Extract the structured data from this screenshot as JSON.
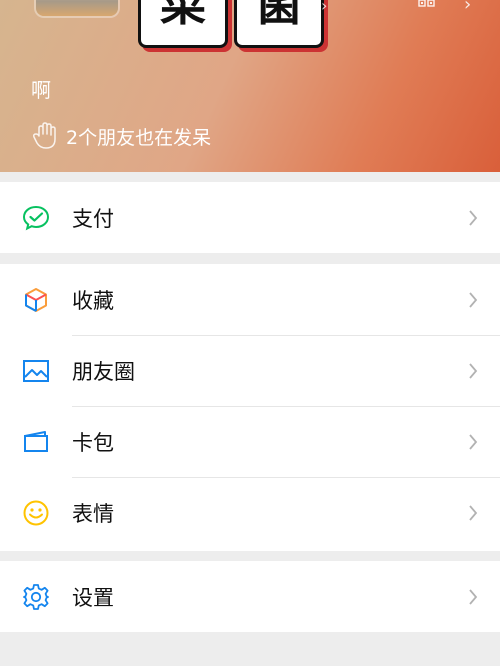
{
  "header": {
    "sticker_chars": [
      "菜",
      "菌"
    ],
    "status": "啊",
    "friends_note": "2个朋友也在发呆",
    "icons": {
      "avatar": "avatar-photo",
      "qr": "qr-code-icon",
      "arrow": "chevron-right-icon",
      "friends": "hand-icon"
    }
  },
  "groups": [
    {
      "items": [
        {
          "id": "pay",
          "label": "支付",
          "icon": "wechat-pay-icon",
          "color": "#07c160"
        }
      ]
    },
    {
      "items": [
        {
          "id": "favorites",
          "label": "收藏",
          "icon": "cube-icon",
          "color": "#fa9d3b"
        },
        {
          "id": "moments",
          "label": "朋友圈",
          "icon": "image-icon",
          "color": "#1485ee"
        },
        {
          "id": "cards",
          "label": "卡包",
          "icon": "card-icon",
          "color": "#1485ee"
        },
        {
          "id": "stickers",
          "label": "表情",
          "icon": "smile-icon",
          "color": "#ffc300"
        }
      ]
    },
    {
      "items": [
        {
          "id": "settings",
          "label": "设置",
          "icon": "gear-icon",
          "color": "#1485ee"
        }
      ]
    }
  ]
}
